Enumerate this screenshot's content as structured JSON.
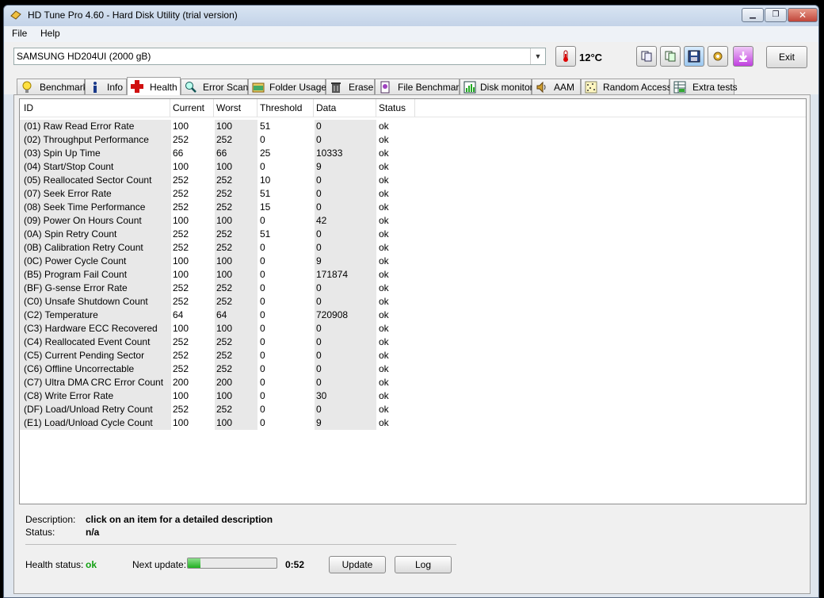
{
  "window": {
    "title": "HD Tune Pro 4.60 - Hard Disk Utility (trial version)"
  },
  "menu": {
    "file": "File",
    "help": "Help"
  },
  "toolbar": {
    "drive": "SAMSUNG HD204UI (2000 gB)",
    "temperature": "12°C",
    "exit_label": "Exit"
  },
  "tabs": [
    {
      "label": "Benchmark",
      "icon": "lightbulb-icon"
    },
    {
      "label": "Info",
      "icon": "info-icon"
    },
    {
      "label": "Health",
      "icon": "red-cross-icon"
    },
    {
      "label": "Error Scan",
      "icon": "magnifier-icon"
    },
    {
      "label": "Folder Usage",
      "icon": "folder-icon"
    },
    {
      "label": "Erase",
      "icon": "trash-icon"
    },
    {
      "label": "File Benchmark",
      "icon": "file-bench-icon"
    },
    {
      "label": "Disk monitor",
      "icon": "chart-icon"
    },
    {
      "label": "AAM",
      "icon": "speaker-icon"
    },
    {
      "label": "Random Access",
      "icon": "random-access-icon"
    },
    {
      "label": "Extra tests",
      "icon": "extra-tests-icon"
    }
  ],
  "health": {
    "columns": {
      "id": "ID",
      "current": "Current",
      "worst": "Worst",
      "threshold": "Threshold",
      "data": "Data",
      "status": "Status"
    },
    "rows": [
      {
        "id": "(01) Raw Read Error Rate",
        "current": "100",
        "worst": "100",
        "threshold": "51",
        "data": "0",
        "status": "ok"
      },
      {
        "id": "(02) Throughput Performance",
        "current": "252",
        "worst": "252",
        "threshold": "0",
        "data": "0",
        "status": "ok"
      },
      {
        "id": "(03) Spin Up Time",
        "current": "66",
        "worst": "66",
        "threshold": "25",
        "data": "10333",
        "status": "ok"
      },
      {
        "id": "(04) Start/Stop Count",
        "current": "100",
        "worst": "100",
        "threshold": "0",
        "data": "9",
        "status": "ok"
      },
      {
        "id": "(05) Reallocated Sector Count",
        "current": "252",
        "worst": "252",
        "threshold": "10",
        "data": "0",
        "status": "ok"
      },
      {
        "id": "(07) Seek Error Rate",
        "current": "252",
        "worst": "252",
        "threshold": "51",
        "data": "0",
        "status": "ok"
      },
      {
        "id": "(08) Seek Time Performance",
        "current": "252",
        "worst": "252",
        "threshold": "15",
        "data": "0",
        "status": "ok"
      },
      {
        "id": "(09) Power On Hours Count",
        "current": "100",
        "worst": "100",
        "threshold": "0",
        "data": "42",
        "status": "ok"
      },
      {
        "id": "(0A) Spin Retry Count",
        "current": "252",
        "worst": "252",
        "threshold": "51",
        "data": "0",
        "status": "ok"
      },
      {
        "id": "(0B) Calibration Retry Count",
        "current": "252",
        "worst": "252",
        "threshold": "0",
        "data": "0",
        "status": "ok"
      },
      {
        "id": "(0C) Power Cycle Count",
        "current": "100",
        "worst": "100",
        "threshold": "0",
        "data": "9",
        "status": "ok"
      },
      {
        "id": "(B5) Program Fail Count",
        "current": "100",
        "worst": "100",
        "threshold": "0",
        "data": "171874",
        "status": "ok"
      },
      {
        "id": "(BF) G-sense Error Rate",
        "current": "252",
        "worst": "252",
        "threshold": "0",
        "data": "0",
        "status": "ok"
      },
      {
        "id": "(C0) Unsafe Shutdown Count",
        "current": "252",
        "worst": "252",
        "threshold": "0",
        "data": "0",
        "status": "ok"
      },
      {
        "id": "(C2) Temperature",
        "current": "64",
        "worst": "64",
        "threshold": "0",
        "data": "720908",
        "status": "ok"
      },
      {
        "id": "(C3) Hardware ECC Recovered",
        "current": "100",
        "worst": "100",
        "threshold": "0",
        "data": "0",
        "status": "ok"
      },
      {
        "id": "(C4) Reallocated Event Count",
        "current": "252",
        "worst": "252",
        "threshold": "0",
        "data": "0",
        "status": "ok"
      },
      {
        "id": "(C5) Current Pending Sector",
        "current": "252",
        "worst": "252",
        "threshold": "0",
        "data": "0",
        "status": "ok"
      },
      {
        "id": "(C6) Offline Uncorrectable",
        "current": "252",
        "worst": "252",
        "threshold": "0",
        "data": "0",
        "status": "ok"
      },
      {
        "id": "(C7) Ultra DMA CRC Error Count",
        "current": "200",
        "worst": "200",
        "threshold": "0",
        "data": "0",
        "status": "ok"
      },
      {
        "id": "(C8) Write Error Rate",
        "current": "100",
        "worst": "100",
        "threshold": "0",
        "data": "30",
        "status": "ok"
      },
      {
        "id": "(DF) Load/Unload Retry Count",
        "current": "252",
        "worst": "252",
        "threshold": "0",
        "data": "0",
        "status": "ok"
      },
      {
        "id": "(E1) Load/Unload Cycle Count",
        "current": "100",
        "worst": "100",
        "threshold": "0",
        "data": "9",
        "status": "ok"
      }
    ]
  },
  "details": {
    "description_label": "Description:",
    "description_value": "click on an item for a detailed description",
    "status_label": "Status:",
    "status_value": "n/a",
    "health_label": "Health status:",
    "health_value": "ok",
    "next_update_label": "Next update:",
    "next_update_progress": 0.14,
    "next_update_time": "0:52",
    "update_label": "Update",
    "log_label": "Log"
  },
  "colors": {
    "ok_green": "#12a012",
    "progress_green": "#22b022"
  }
}
